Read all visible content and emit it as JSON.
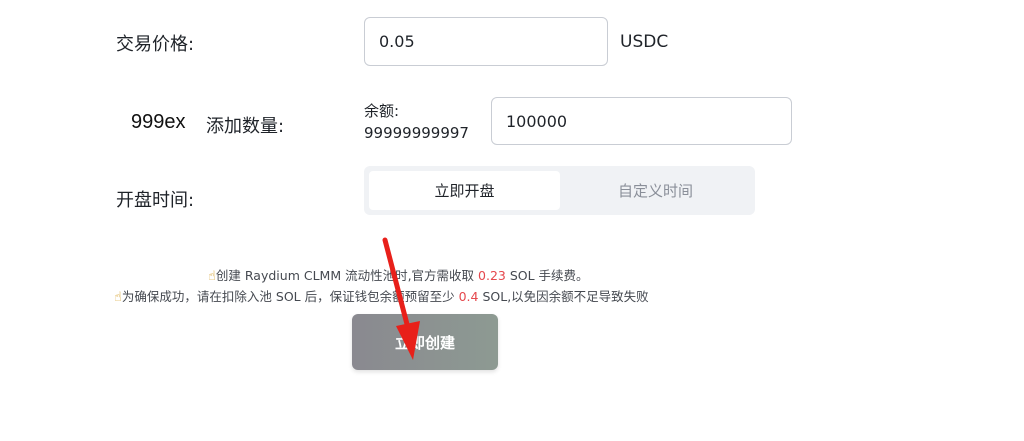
{
  "price": {
    "label": "交易价格:",
    "value": "0.05",
    "unit": "USDC"
  },
  "quantity": {
    "token": "999ex",
    "label": "添加数量:",
    "balance_label": "余额:",
    "balance_value": "99999999997",
    "value": "100000"
  },
  "open_time": {
    "label": "开盘时间:",
    "options": [
      "立即开盘",
      "自定义时间"
    ],
    "selected": "立即开盘"
  },
  "notice": {
    "line1_pre": "创建 Raydium CLMM 流动性池时,官方需收取 ",
    "line1_fee": "0.23",
    "line1_post": " SOL 手续费。",
    "line2_pre": "为确保成功，请在扣除入池 SOL 后，保证钱包余额预留至少 ",
    "line2_min": "0.4",
    "line2_post": " SOL,以免因余额不足导致失败",
    "icon": "pointing-hand-icon"
  },
  "create_button": {
    "label": "立即创建"
  },
  "annotation": {
    "arrow_color": "#e8201a"
  }
}
